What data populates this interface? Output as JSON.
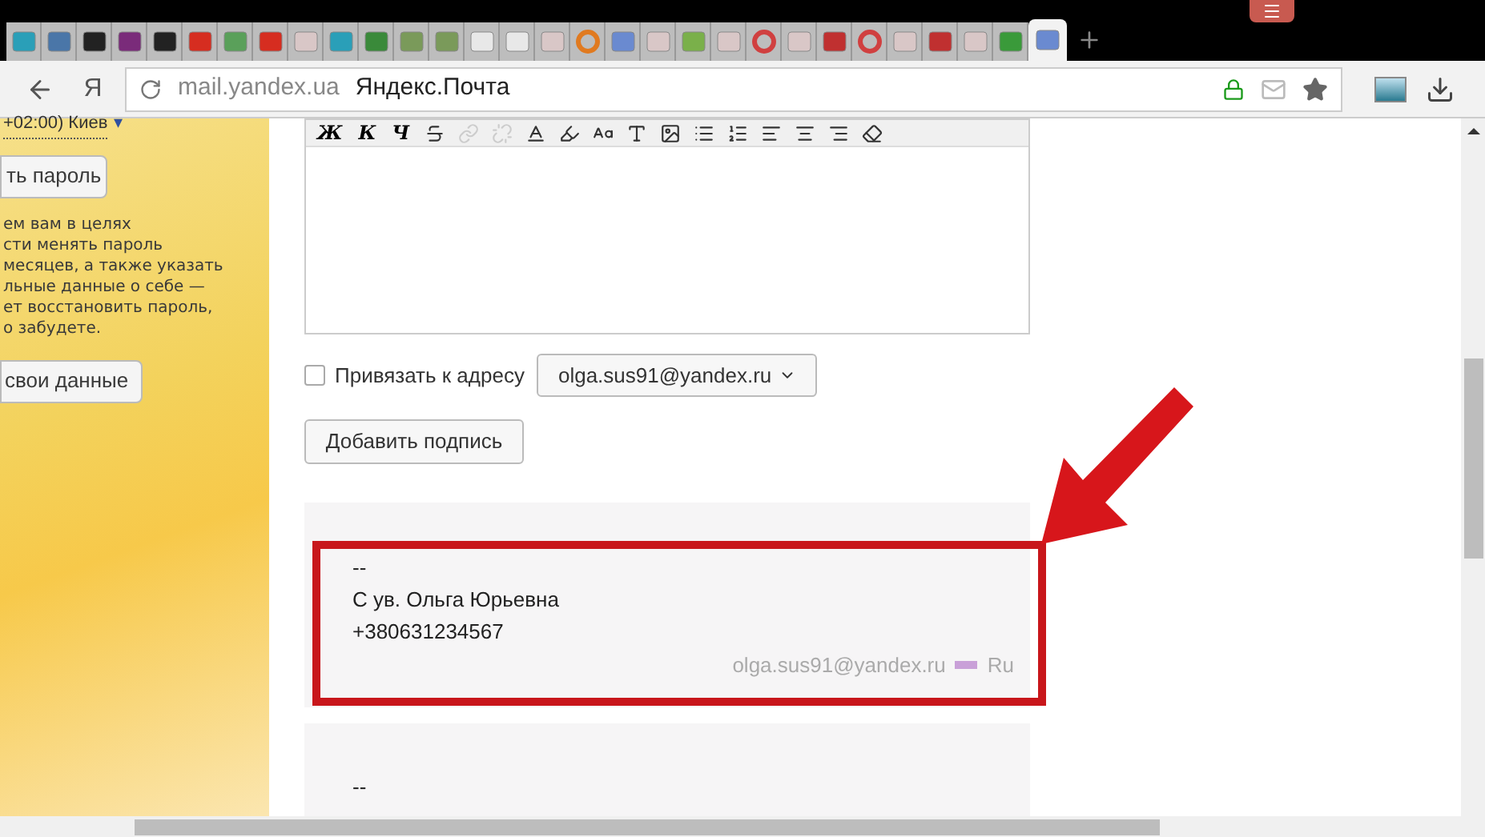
{
  "browser": {
    "tabs": [
      {
        "kind": "monitor",
        "selected": false
      },
      {
        "kind": "vk",
        "selected": false
      },
      {
        "kind": "envelope-open",
        "selected": false
      },
      {
        "kind": "devil",
        "selected": false
      },
      {
        "kind": "s",
        "selected": false
      },
      {
        "kind": "youtube",
        "selected": false
      },
      {
        "kind": "puzzle",
        "selected": false
      },
      {
        "kind": "youtube",
        "selected": false
      },
      {
        "kind": "yandex",
        "selected": false
      },
      {
        "kind": "monitor",
        "selected": false
      },
      {
        "kind": "windows",
        "selected": false
      },
      {
        "kind": "wh",
        "selected": false
      },
      {
        "kind": "wh",
        "selected": false
      },
      {
        "kind": "page",
        "selected": false
      },
      {
        "kind": "page",
        "selected": false
      },
      {
        "kind": "yandex",
        "selected": false
      },
      {
        "kind": "swirl",
        "selected": false
      },
      {
        "kind": "mail",
        "selected": false
      },
      {
        "kind": "yandex",
        "selected": false
      },
      {
        "kind": "leaf",
        "selected": false
      },
      {
        "kind": "yandex",
        "selected": false
      },
      {
        "kind": "ring",
        "selected": false
      },
      {
        "kind": "yandex",
        "selected": false
      },
      {
        "kind": "tomato",
        "selected": false
      },
      {
        "kind": "ring",
        "selected": false
      },
      {
        "kind": "yandex",
        "selected": false
      },
      {
        "kind": "tomato",
        "selected": false
      },
      {
        "kind": "yandex",
        "selected": false
      },
      {
        "kind": "mail-green",
        "selected": false
      },
      {
        "kind": "mail",
        "selected": true
      }
    ],
    "yandex_button": "Я",
    "url": "mail.yandex.ua",
    "page_title": "Яндекс.Почта"
  },
  "sidebar": {
    "timezone": "+02:00) Киев",
    "timezone_caret": "▾",
    "password_button": "ть пароль",
    "hint_lines": [
      "ем вам в целях",
      "сти менять пароль",
      "месяцев, а также указать",
      "льные данные о себе —",
      "ет восстановить пароль,",
      "о забудете."
    ],
    "data_button": "свои данные"
  },
  "editor": {
    "toolbar": [
      {
        "kind": "text",
        "label": "Ж"
      },
      {
        "kind": "text",
        "label": "К"
      },
      {
        "kind": "text",
        "label": "Ч"
      },
      {
        "kind": "strike"
      },
      {
        "kind": "link",
        "disabled": true
      },
      {
        "kind": "unlink",
        "disabled": true
      },
      {
        "kind": "text-color"
      },
      {
        "kind": "highlight"
      },
      {
        "kind": "font-size"
      },
      {
        "kind": "font"
      },
      {
        "kind": "image"
      },
      {
        "kind": "bullets"
      },
      {
        "kind": "numbers"
      },
      {
        "kind": "align-left"
      },
      {
        "kind": "align-center"
      },
      {
        "kind": "align-right"
      },
      {
        "kind": "clear-format"
      }
    ]
  },
  "bind": {
    "label": "Привязать к адресу",
    "checked": false,
    "address": "olga.sus91@yandex.ru"
  },
  "add_signature_button": "Добавить подпись",
  "signatures": [
    {
      "lines": [
        "--",
        "С ув. Ольга Юрьевна",
        "+380631234567"
      ],
      "email": "olga.sus91@yandex.ru",
      "language": "Ru",
      "highlighted": true
    },
    {
      "lines": [
        "--"
      ],
      "highlighted": false
    }
  ]
}
